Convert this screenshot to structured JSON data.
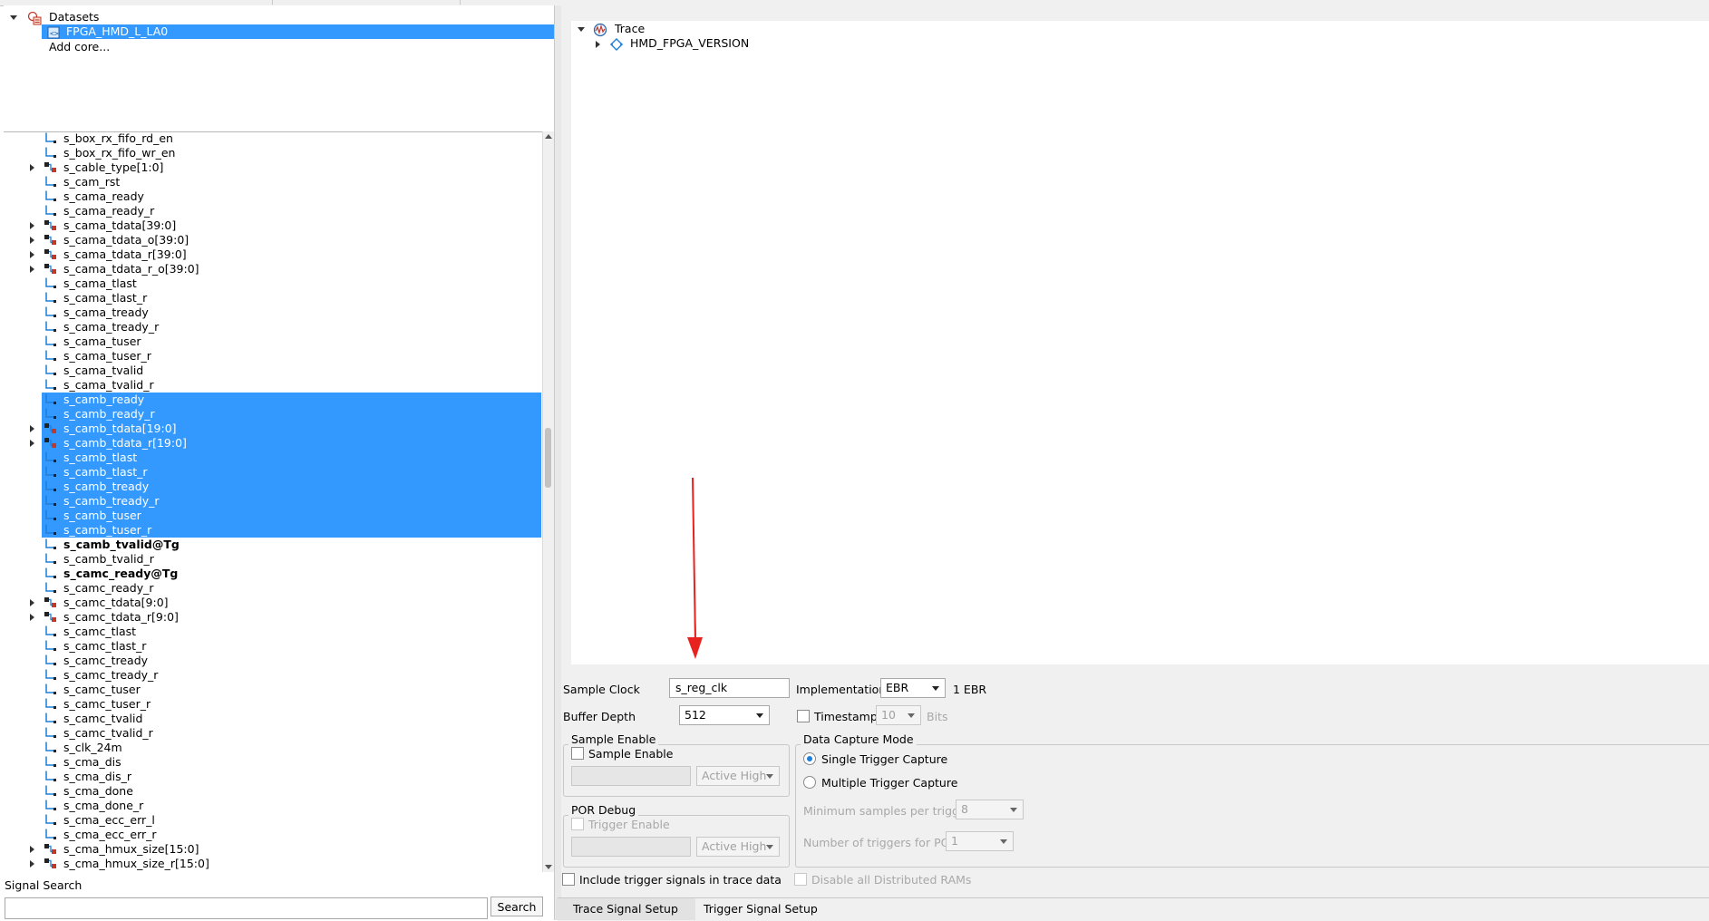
{
  "datasets": {
    "root_label": "Datasets",
    "selected_core": "FPGA_HMD_L_LA0",
    "add_core": "Add core..."
  },
  "signals": [
    {
      "name": "s_box_rx_fifo_rd_en",
      "bus": false,
      "bold": false,
      "selected": false
    },
    {
      "name": "s_box_rx_fifo_wr_en",
      "bus": false,
      "bold": false,
      "selected": false
    },
    {
      "name": "s_cable_type[1:0]",
      "bus": true,
      "bold": false,
      "selected": false
    },
    {
      "name": "s_cam_rst",
      "bus": false,
      "bold": false,
      "selected": false
    },
    {
      "name": "s_cama_ready",
      "bus": false,
      "bold": false,
      "selected": false
    },
    {
      "name": "s_cama_ready_r",
      "bus": false,
      "bold": false,
      "selected": false
    },
    {
      "name": "s_cama_tdata[39:0]",
      "bus": true,
      "bold": false,
      "selected": false
    },
    {
      "name": "s_cama_tdata_o[39:0]",
      "bus": true,
      "bold": false,
      "selected": false
    },
    {
      "name": "s_cama_tdata_r[39:0]",
      "bus": true,
      "bold": false,
      "selected": false
    },
    {
      "name": "s_cama_tdata_r_o[39:0]",
      "bus": true,
      "bold": false,
      "selected": false
    },
    {
      "name": "s_cama_tlast",
      "bus": false,
      "bold": false,
      "selected": false
    },
    {
      "name": "s_cama_tlast_r",
      "bus": false,
      "bold": false,
      "selected": false
    },
    {
      "name": "s_cama_tready",
      "bus": false,
      "bold": false,
      "selected": false
    },
    {
      "name": "s_cama_tready_r",
      "bus": false,
      "bold": false,
      "selected": false
    },
    {
      "name": "s_cama_tuser",
      "bus": false,
      "bold": false,
      "selected": false
    },
    {
      "name": "s_cama_tuser_r",
      "bus": false,
      "bold": false,
      "selected": false
    },
    {
      "name": "s_cama_tvalid",
      "bus": false,
      "bold": false,
      "selected": false
    },
    {
      "name": "s_cama_tvalid_r",
      "bus": false,
      "bold": false,
      "selected": false
    },
    {
      "name": "s_camb_ready",
      "bus": false,
      "bold": false,
      "selected": true
    },
    {
      "name": "s_camb_ready_r",
      "bus": false,
      "bold": false,
      "selected": true
    },
    {
      "name": "s_camb_tdata[19:0]",
      "bus": true,
      "bold": false,
      "selected": true
    },
    {
      "name": "s_camb_tdata_r[19:0]",
      "bus": true,
      "bold": false,
      "selected": true
    },
    {
      "name": "s_camb_tlast",
      "bus": false,
      "bold": false,
      "selected": true
    },
    {
      "name": "s_camb_tlast_r",
      "bus": false,
      "bold": false,
      "selected": true
    },
    {
      "name": "s_camb_tready",
      "bus": false,
      "bold": false,
      "selected": true
    },
    {
      "name": "s_camb_tready_r",
      "bus": false,
      "bold": false,
      "selected": true
    },
    {
      "name": "s_camb_tuser",
      "bus": false,
      "bold": false,
      "selected": true
    },
    {
      "name": "s_camb_tuser_r",
      "bus": false,
      "bold": false,
      "selected": true
    },
    {
      "name": "s_camb_tvalid@Tg",
      "bus": false,
      "bold": true,
      "selected": false
    },
    {
      "name": "s_camb_tvalid_r",
      "bus": false,
      "bold": false,
      "selected": false
    },
    {
      "name": "s_camc_ready@Tg",
      "bus": false,
      "bold": true,
      "selected": false
    },
    {
      "name": "s_camc_ready_r",
      "bus": false,
      "bold": false,
      "selected": false
    },
    {
      "name": "s_camc_tdata[9:0]",
      "bus": true,
      "bold": false,
      "selected": false
    },
    {
      "name": "s_camc_tdata_r[9:0]",
      "bus": true,
      "bold": false,
      "selected": false
    },
    {
      "name": "s_camc_tlast",
      "bus": false,
      "bold": false,
      "selected": false
    },
    {
      "name": "s_camc_tlast_r",
      "bus": false,
      "bold": false,
      "selected": false
    },
    {
      "name": "s_camc_tready",
      "bus": false,
      "bold": false,
      "selected": false
    },
    {
      "name": "s_camc_tready_r",
      "bus": false,
      "bold": false,
      "selected": false
    },
    {
      "name": "s_camc_tuser",
      "bus": false,
      "bold": false,
      "selected": false
    },
    {
      "name": "s_camc_tuser_r",
      "bus": false,
      "bold": false,
      "selected": false
    },
    {
      "name": "s_camc_tvalid",
      "bus": false,
      "bold": false,
      "selected": false
    },
    {
      "name": "s_camc_tvalid_r",
      "bus": false,
      "bold": false,
      "selected": false
    },
    {
      "name": "s_clk_24m",
      "bus": false,
      "bold": false,
      "selected": false
    },
    {
      "name": "s_cma_dis",
      "bus": false,
      "bold": false,
      "selected": false
    },
    {
      "name": "s_cma_dis_r",
      "bus": false,
      "bold": false,
      "selected": false
    },
    {
      "name": "s_cma_done",
      "bus": false,
      "bold": false,
      "selected": false
    },
    {
      "name": "s_cma_done_r",
      "bus": false,
      "bold": false,
      "selected": false
    },
    {
      "name": "s_cma_ecc_err_l",
      "bus": false,
      "bold": false,
      "selected": false
    },
    {
      "name": "s_cma_ecc_err_r",
      "bus": false,
      "bold": false,
      "selected": false
    },
    {
      "name": "s_cma_hmux_size[15:0]",
      "bus": true,
      "bold": false,
      "selected": false
    },
    {
      "name": "s_cma_hmux_size_r[15:0]",
      "bus": true,
      "bold": false,
      "selected": false
    }
  ],
  "signal_search": {
    "label": "Signal Search",
    "value": "",
    "button": "Search"
  },
  "trace": {
    "root": "Trace",
    "child": "HMD_FPGA_VERSION"
  },
  "settings": {
    "sample_clock_label": "Sample Clock",
    "sample_clock_value": "s_reg_clk",
    "implementation_label": "Implementation",
    "implementation_value": "EBR",
    "ebr_count": "1 EBR",
    "buffer_depth_label": "Buffer Depth",
    "buffer_depth_value": "512",
    "timestamp_label": "Timestamp",
    "timestamp_value": "10",
    "timestamp_unit": "Bits",
    "sample_enable_group": "Sample Enable",
    "sample_enable_checkbox": "Sample Enable",
    "sample_enable_polarity": "Active High",
    "por_debug_group": "POR Debug",
    "trigger_enable_checkbox": "Trigger Enable",
    "por_polarity": "Active High",
    "data_capture_group": "Data Capture Mode",
    "single_trigger": "Single Trigger Capture",
    "multiple_trigger": "Multiple Trigger Capture",
    "min_samples_label": "Minimum samples per trigger",
    "min_samples_value": "8",
    "num_triggers_label": "Number of triggers for POR",
    "num_triggers_value": "1",
    "include_trigger_signals": "Include trigger signals in trace data",
    "disable_distributed_rams": "Disable all Distributed RAMs"
  },
  "tabs": {
    "trace_signal_setup": "Trace Signal Setup",
    "trigger_signal_setup": "Trigger Signal Setup"
  },
  "colors": {
    "selection": "#3399ff",
    "annotation_arrow": "#e8231f"
  }
}
